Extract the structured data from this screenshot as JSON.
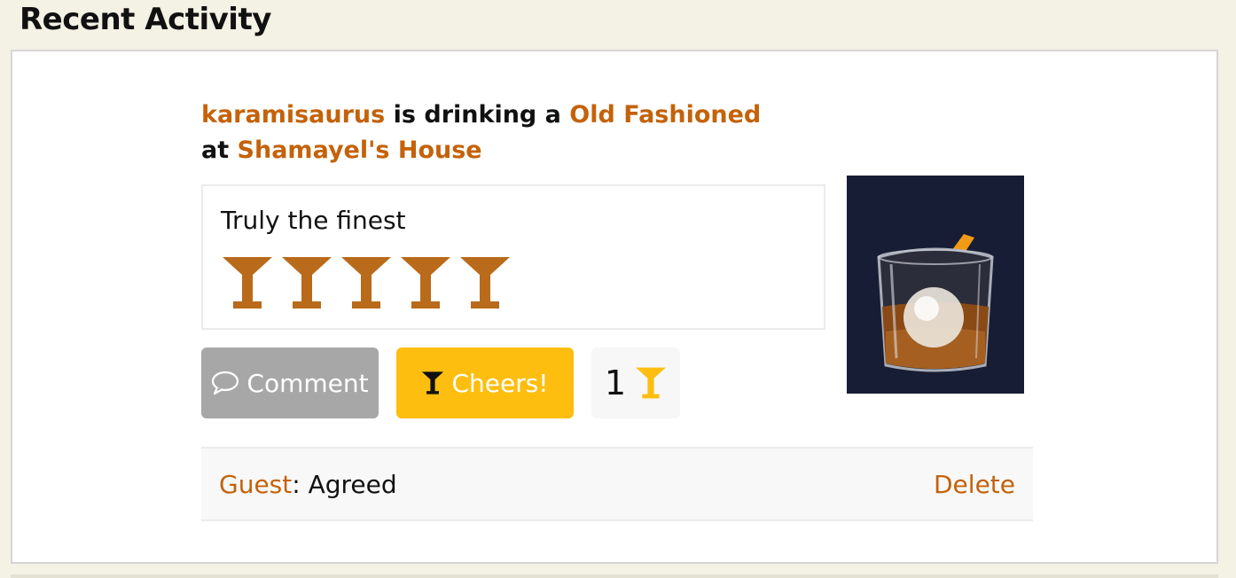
{
  "section": {
    "title": "Recent Activity"
  },
  "activity": {
    "user": "karamisaurus",
    "verb": "is drinking a",
    "drink": "Old Fashioned",
    "at_word": "at",
    "venue": "Shamayel's House",
    "review": "Truly the finest",
    "rating": 5,
    "rating_max": 5,
    "rating_icon": "martini-glass-icon",
    "photo_alt": "Old Fashioned cocktail"
  },
  "actions": {
    "comment_label": "Comment",
    "cheers_label": "Cheers!",
    "cheers_count": "1"
  },
  "comments": [
    {
      "author": "Guest",
      "separator": ": ",
      "text": "Agreed",
      "delete_label": "Delete"
    }
  ],
  "colors": {
    "accent": "#c4620a",
    "rating": "#b96a1a",
    "cheers": "#fdbe10",
    "comment_button": "#a7a7a7",
    "background": "#f4f1e5"
  }
}
